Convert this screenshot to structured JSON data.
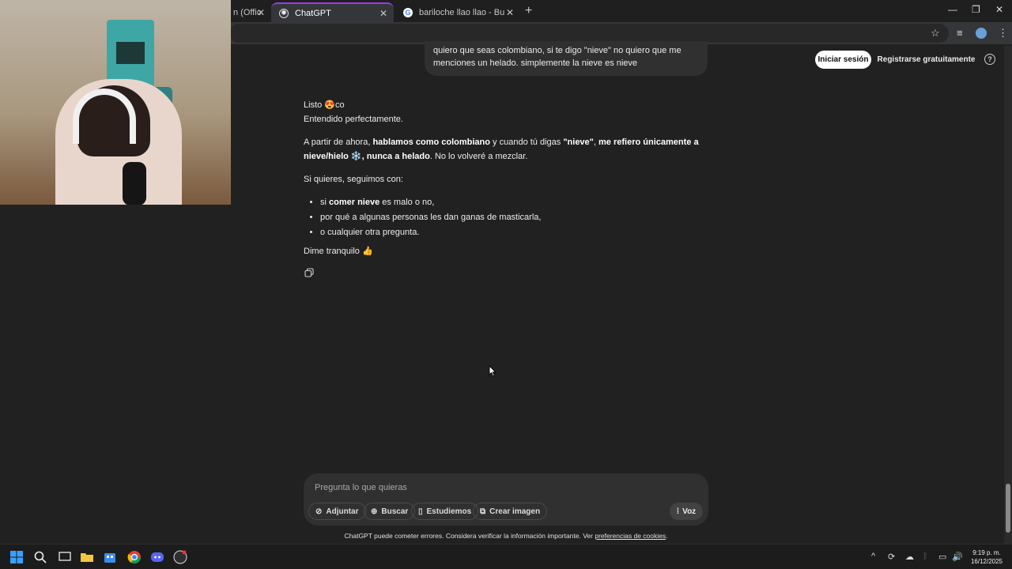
{
  "browser": {
    "tabs": [
      {
        "label": "n (Offic",
        "active": false
      },
      {
        "label": "ChatGPT",
        "active": true
      },
      {
        "label": "bariloche llao llao - Buscar con",
        "active": false
      }
    ],
    "new_tab": "+",
    "window_controls": {
      "minimize": "—",
      "restore": "❐",
      "close": "✕"
    }
  },
  "header": {
    "login_label": "Iniciar sesión",
    "signup_label": "Registrarse gratuitamente",
    "help_label": "?"
  },
  "conversation": {
    "user_message": "quiero que seas colombiano, si te digo \"nieve\" no quiero que me menciones un helado. simplemente la nieve es nieve",
    "assistant": {
      "line1_text": "Listo ",
      "line1_emoji": "😍",
      "line1_suffix": "co",
      "line2": "Entendido perfectamente.",
      "p2": {
        "a": "A partir de ahora, ",
        "b": "hablamos como colombiano",
        "c": " y cuando tú digas ",
        "d": "\"nieve\"",
        "e": ", ",
        "f": "me refiero únicamente a nieve/hielo",
        "g": " ❄️",
        "h": ", ",
        "i": "nunca a helado",
        "j": ". No lo volveré a mezclar."
      },
      "p3": "Si quieres, seguimos con:",
      "bullets": {
        "b1_a": "si ",
        "b1_b": "comer nieve",
        "b1_c": " es malo o no,",
        "b2": "por qué a algunas personas les dan ganas de masticarla,",
        "b3": "o cualquier otra pregunta."
      },
      "closing": "Dime tranquilo ",
      "closing_emoji": "👍"
    }
  },
  "composer": {
    "placeholder": "Pregunta lo que quieras",
    "buttons": {
      "attach": "Adjuntar",
      "search": "Buscar",
      "study": "Estudiemos",
      "image": "Crear imagen",
      "voice": "Voz"
    }
  },
  "disclaimer": {
    "text": "ChatGPT puede cometer errores. Considera verificar la información importante. Ver ",
    "link": "preferencias de cookies",
    "end": "."
  },
  "taskbar": {
    "time": "9:19 p. m.",
    "date": "16/12/2025"
  }
}
